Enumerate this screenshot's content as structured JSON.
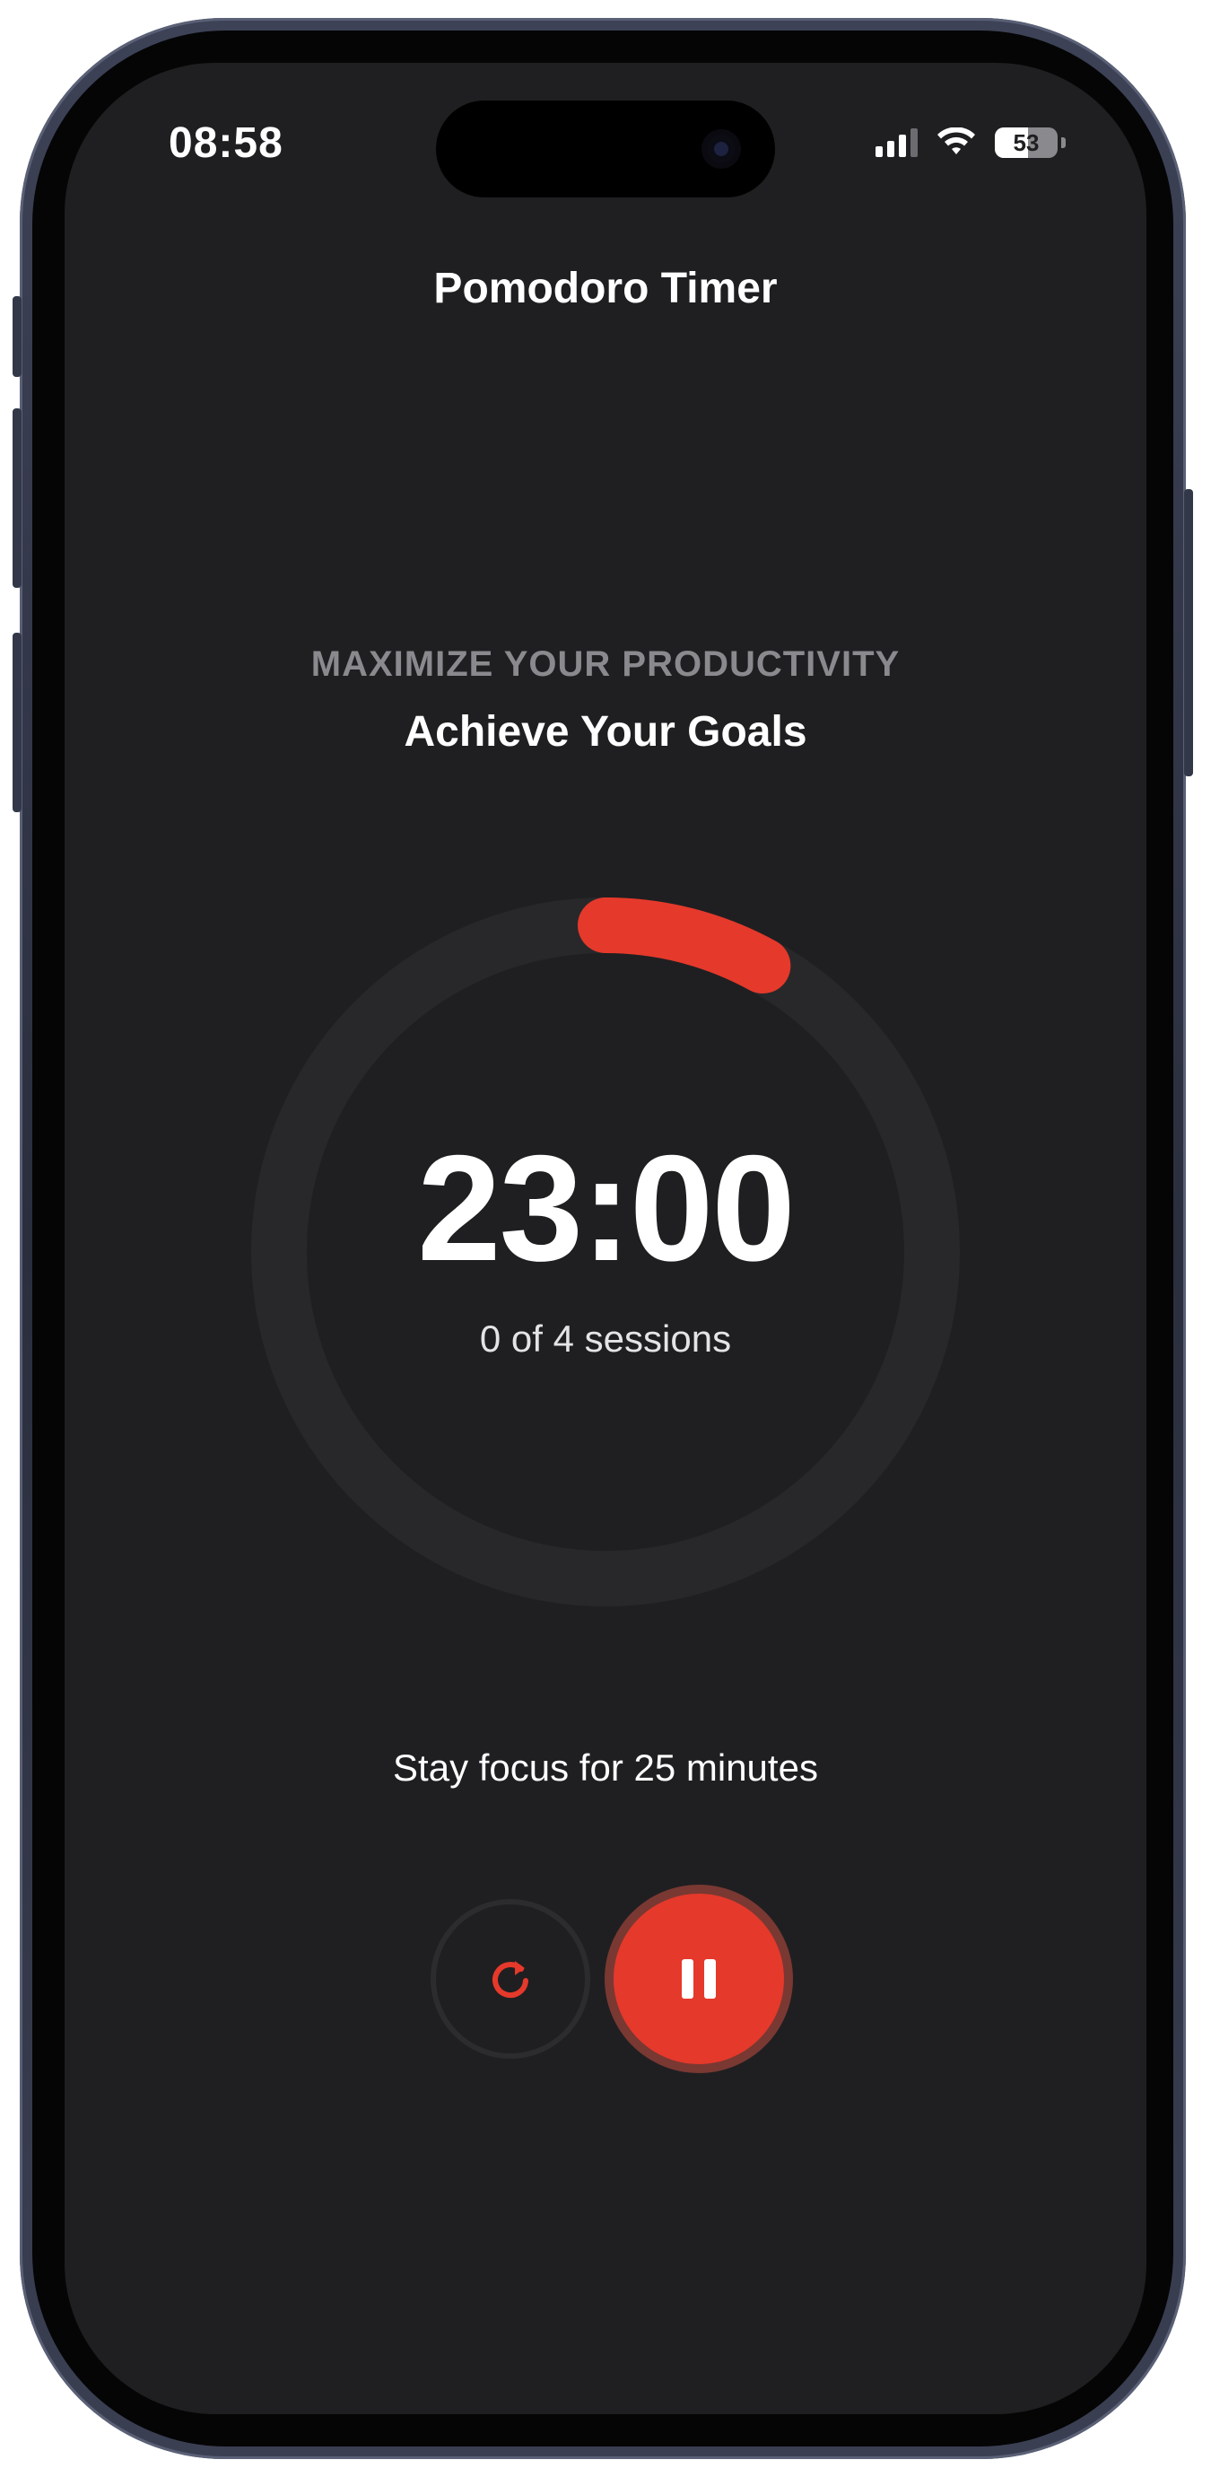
{
  "status_bar": {
    "time": "08:58",
    "battery_percent": "53",
    "battery_level": 0.53,
    "signal_bars_active": 3,
    "signal_bars_total": 4
  },
  "header": {
    "title": "Pomodoro Timer"
  },
  "hero": {
    "eyebrow": "MAXIMIZE YOUR PRODUCTIVITY",
    "headline": "Achieve Your Goals"
  },
  "timer": {
    "display": "23:00",
    "sessions_text": "0 of 4 sessions",
    "elapsed_fraction": 0.08,
    "progress_color": "#E5392B",
    "track_color": "#28282A"
  },
  "focus_message": "Stay focus for 25 minutes",
  "controls": {
    "reset_icon": "reset-icon",
    "pause_icon": "pause-icon",
    "accent_color": "#E5392B"
  }
}
